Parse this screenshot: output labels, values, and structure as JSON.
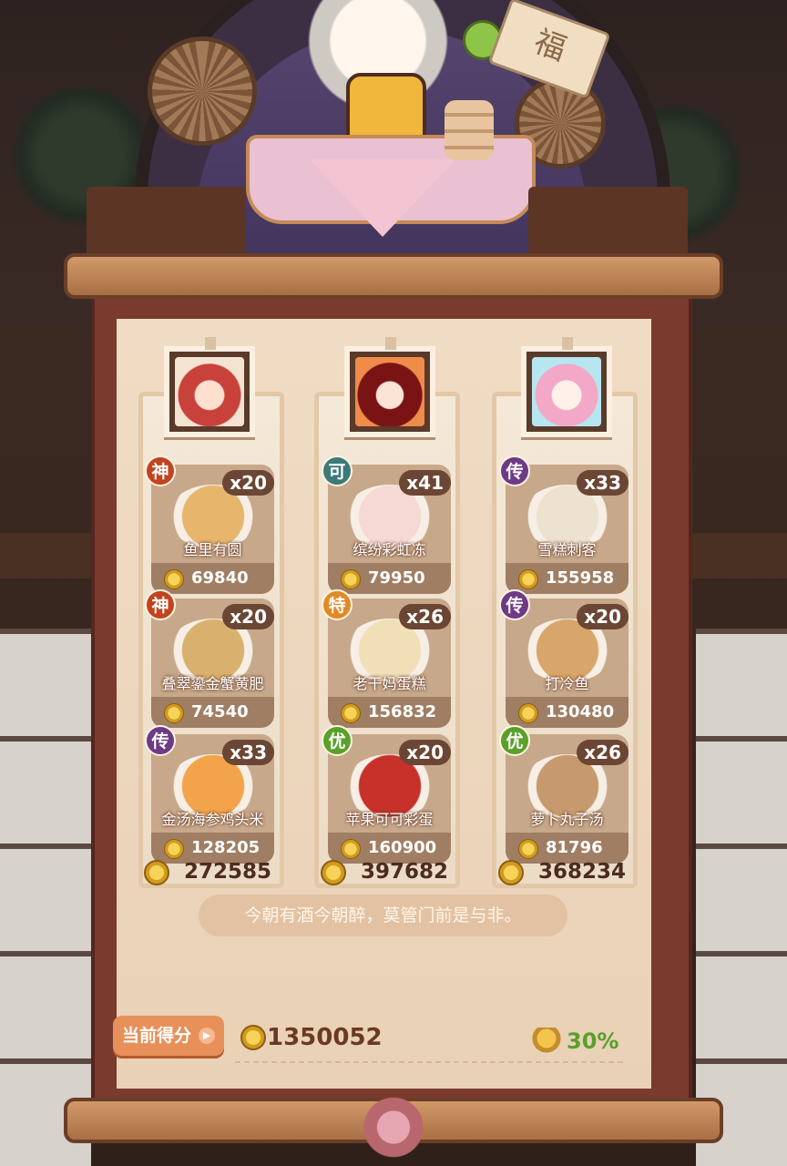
{
  "scene": {
    "sign_text": "福"
  },
  "columns": [
    {
      "portrait": "red-haired-cookie-avatar",
      "dishes": [
        {
          "grade": "神",
          "grade_color": "#c4431f",
          "count": "x20",
          "name": "鱼里有圆",
          "price": "69840"
        },
        {
          "grade": "神",
          "grade_color": "#c4431f",
          "count": "x20",
          "name": "叠翠鎏金蟹黄肥",
          "price": "74540"
        },
        {
          "grade": "传",
          "grade_color": "#6d3a86",
          "count": "x33",
          "name": "金汤海参鸡头米",
          "price": "128205"
        }
      ],
      "total": "272585"
    },
    {
      "portrait": "dark-red-cookie-avatar",
      "dishes": [
        {
          "grade": "可",
          "grade_color": "#3c7a78",
          "count": "x41",
          "name": "缤纷彩虹冻",
          "price": "79950"
        },
        {
          "grade": "特",
          "grade_color": "#e08a25",
          "count": "x26",
          "name": "老干妈蛋糕",
          "price": "156832"
        },
        {
          "grade": "优",
          "grade_color": "#5aa02b",
          "count": "x20",
          "name": "苹果可可彩蛋",
          "price": "160900"
        }
      ],
      "total": "397682"
    },
    {
      "portrait": "pink-haired-cookie-avatar",
      "dishes": [
        {
          "grade": "传",
          "grade_color": "#6d3a86",
          "count": "x33",
          "name": "雪糕刺客",
          "price": "155958"
        },
        {
          "grade": "传",
          "grade_color": "#6d3a86",
          "count": "x20",
          "name": "打冷鱼",
          "price": "130480"
        },
        {
          "grade": "优",
          "grade_color": "#5aa02b",
          "count": "x26",
          "name": "萝卜丸子汤",
          "price": "81796"
        }
      ],
      "total": "368234"
    }
  ],
  "quote": "今朝有酒今朝醉，莫管门前是与非。",
  "score": {
    "label": "当前得分",
    "value": "1350052",
    "bonus": "30%"
  },
  "icons": {
    "coin": "gold-coin-icon",
    "play": "play-arrow-icon",
    "bonus": "lucky-bag-icon"
  }
}
